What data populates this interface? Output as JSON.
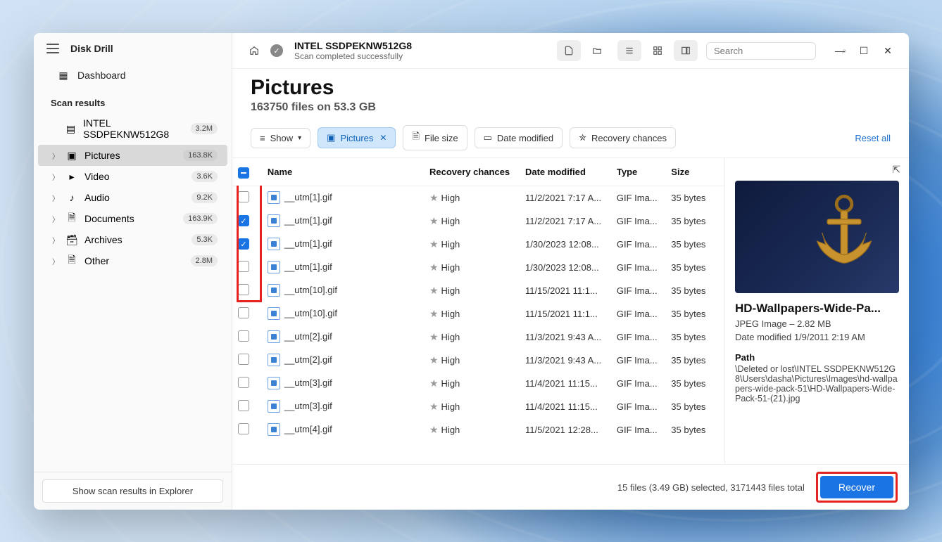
{
  "app": {
    "title": "Disk Drill"
  },
  "header": {
    "device": "INTEL SSDPEKNW512G8",
    "status": "Scan completed successfully",
    "search_placeholder": "Search"
  },
  "sidebar": {
    "dashboard": "Dashboard",
    "section": "Scan results",
    "items": [
      {
        "label": "INTEL SSDPEKNW512G8",
        "badge": "3.2M"
      },
      {
        "label": "Pictures",
        "badge": "163.8K"
      },
      {
        "label": "Video",
        "badge": "3.6K"
      },
      {
        "label": "Audio",
        "badge": "9.2K"
      },
      {
        "label": "Documents",
        "badge": "163.9K"
      },
      {
        "label": "Archives",
        "badge": "5.3K"
      },
      {
        "label": "Other",
        "badge": "2.8M"
      }
    ],
    "footer_btn": "Show scan results in Explorer"
  },
  "page": {
    "title": "Pictures",
    "subtitle": "163750 files on 53.3 GB"
  },
  "filters": {
    "show": "Show",
    "pictures": "Pictures",
    "filesize": "File size",
    "datemod": "Date modified",
    "recchance": "Recovery chances",
    "reset": "Reset all"
  },
  "columns": {
    "name": "Name",
    "rc": "Recovery chances",
    "dm": "Date modified",
    "type": "Type",
    "size": "Size"
  },
  "rows": [
    {
      "checked": false,
      "name": "__utm[1].gif",
      "rc": "High",
      "dm": "11/2/2021 7:17 A...",
      "type": "GIF Ima...",
      "size": "35 bytes"
    },
    {
      "checked": true,
      "name": "__utm[1].gif",
      "rc": "High",
      "dm": "11/2/2021 7:17 A...",
      "type": "GIF Ima...",
      "size": "35 bytes"
    },
    {
      "checked": true,
      "name": "__utm[1].gif",
      "rc": "High",
      "dm": "1/30/2023 12:08...",
      "type": "GIF Ima...",
      "size": "35 bytes"
    },
    {
      "checked": false,
      "name": "__utm[1].gif",
      "rc": "High",
      "dm": "1/30/2023 12:08...",
      "type": "GIF Ima...",
      "size": "35 bytes"
    },
    {
      "checked": false,
      "name": "__utm[10].gif",
      "rc": "High",
      "dm": "11/15/2021 11:1...",
      "type": "GIF Ima...",
      "size": "35 bytes"
    },
    {
      "checked": false,
      "name": "__utm[10].gif",
      "rc": "High",
      "dm": "11/15/2021 11:1...",
      "type": "GIF Ima...",
      "size": "35 bytes"
    },
    {
      "checked": false,
      "name": "__utm[2].gif",
      "rc": "High",
      "dm": "11/3/2021 9:43 A...",
      "type": "GIF Ima...",
      "size": "35 bytes"
    },
    {
      "checked": false,
      "name": "__utm[2].gif",
      "rc": "High",
      "dm": "11/3/2021 9:43 A...",
      "type": "GIF Ima...",
      "size": "35 bytes"
    },
    {
      "checked": false,
      "name": "__utm[3].gif",
      "rc": "High",
      "dm": "11/4/2021 11:15...",
      "type": "GIF Ima...",
      "size": "35 bytes"
    },
    {
      "checked": false,
      "name": "__utm[3].gif",
      "rc": "High",
      "dm": "11/4/2021 11:15...",
      "type": "GIF Ima...",
      "size": "35 bytes"
    },
    {
      "checked": false,
      "name": "__utm[4].gif",
      "rc": "High",
      "dm": "11/5/2021 12:28...",
      "type": "GIF Ima...",
      "size": "35 bytes"
    }
  ],
  "preview": {
    "title": "HD-Wallpapers-Wide-Pa...",
    "meta": "JPEG Image – 2.82 MB",
    "modified": "Date modified 1/9/2011 2:19 AM",
    "path_label": "Path",
    "path_value": "\\Deleted or lost\\INTEL SSDPEKNW512G8\\Users\\dasha\\Pictures\\Images\\hd-wallpapers-wide-pack-51\\HD-Wallpapers-Wide-Pack-51-(21).jpg"
  },
  "footer": {
    "summary": "15 files (3.49 GB) selected, 3171443 files total",
    "recover": "Recover"
  }
}
